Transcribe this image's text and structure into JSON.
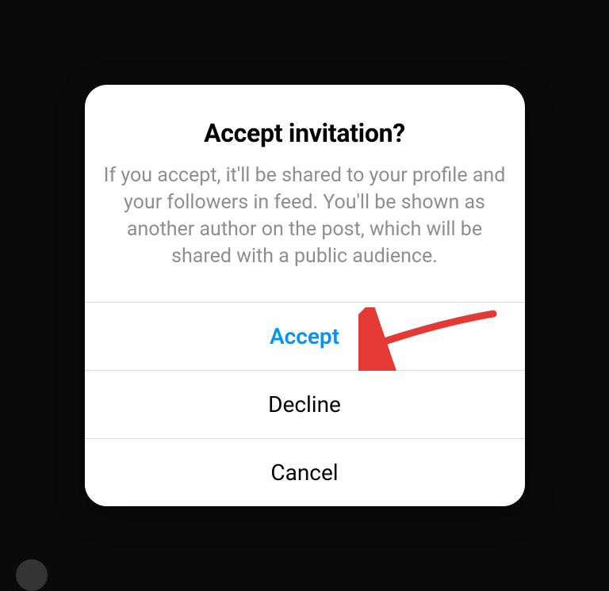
{
  "dialog": {
    "title": "Accept invitation?",
    "message": "If you accept, it'll be shared to your profile and your followers in feed. You'll be shown as another author on the post, which will be shared with a public audience.",
    "buttons": {
      "accept": "Accept",
      "decline": "Decline",
      "cancel": "Cancel"
    }
  },
  "colors": {
    "accent": "#0095f6",
    "text_secondary": "#8e8e8e",
    "divider": "#dbdbdb",
    "annotation": "#e53935"
  }
}
